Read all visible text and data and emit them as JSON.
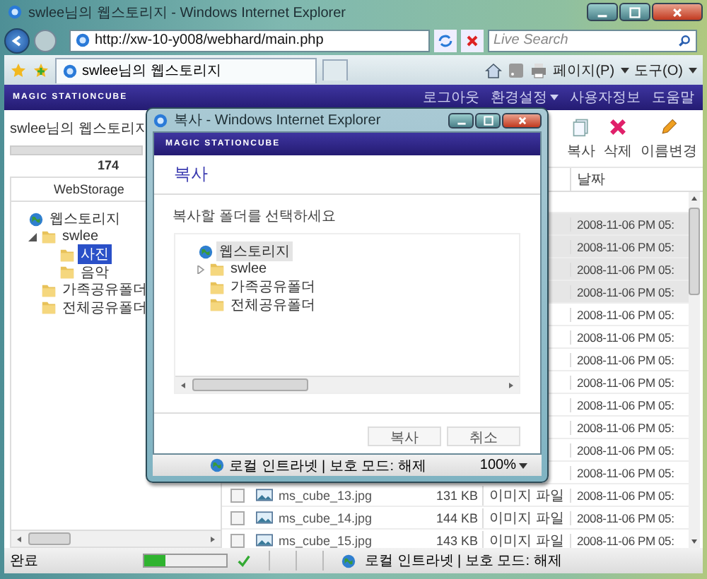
{
  "window": {
    "title": "swlee님의 웹스토리지 - Windows Internet Explorer"
  },
  "address_bar": {
    "url": "http://xw-10-y008/webhard/main.php"
  },
  "search": {
    "placeholder": "Live Search"
  },
  "tab": {
    "label": "swlee님의 웹스토리지"
  },
  "command_bar": [
    "페이지(P)",
    "도구(O)"
  ],
  "site": {
    "logo": "MAGIC STATIONCUBE",
    "links": [
      {
        "label": "로그아웃",
        "dropdown": false
      },
      {
        "label": "환경설정",
        "dropdown": true
      },
      {
        "label": "사용자정보",
        "dropdown": false
      },
      {
        "label": "도움말",
        "dropdown": false
      }
    ]
  },
  "storage": {
    "title": "swlee님의 웹스토리지",
    "usage": "174"
  },
  "tree": {
    "header": "WebStorage",
    "items": [
      {
        "label": "웹스토리지",
        "kind": "root",
        "selected": false,
        "children": [
          {
            "label": "swlee",
            "kind": "expanded_folder",
            "selected": false,
            "children": [
              {
                "label": "사진",
                "kind": "folder",
                "selected": true
              },
              {
                "label": "음악",
                "kind": "folder",
                "selected": false
              }
            ]
          },
          {
            "label": "가족공유폴더",
            "kind": "folder",
            "selected": false
          },
          {
            "label": "전체공유폴더",
            "kind": "folder",
            "selected": false
          }
        ]
      }
    ]
  },
  "toolbar": [
    {
      "label": "복사",
      "kind": "copy"
    },
    {
      "label": "삭제",
      "kind": "delete"
    },
    {
      "label": "이름변경",
      "kind": "rename"
    }
  ],
  "table": {
    "columns": [
      "날짜"
    ],
    "rows": [
      {
        "selected": true,
        "date": "2008-11-06 PM 05:"
      },
      {
        "selected": true,
        "date": "2008-11-06 PM 05:"
      },
      {
        "selected": true,
        "date": "2008-11-06 PM 05:"
      },
      {
        "selected": true,
        "date": "2008-11-06 PM 05:"
      },
      {
        "selected": false,
        "date": "2008-11-06 PM 05:"
      },
      {
        "selected": false,
        "date": "2008-11-06 PM 05:"
      },
      {
        "selected": false,
        "date": "2008-11-06 PM 05:"
      },
      {
        "selected": false,
        "date": "2008-11-06 PM 05:"
      },
      {
        "selected": false,
        "date": "2008-11-06 PM 05:"
      },
      {
        "selected": false,
        "date": "2008-11-06 PM 05:"
      },
      {
        "selected": false,
        "date": "2008-11-06 PM 05:"
      },
      {
        "selected": false,
        "date": "2008-11-06 PM 05:"
      },
      {
        "selected": false,
        "checked": false,
        "name": "ms_cube_13.jpg",
        "size": "131 KB",
        "type": "이미지 파일",
        "date": "2008-11-06 PM 05:"
      },
      {
        "selected": false,
        "checked": false,
        "name": "ms_cube_14.jpg",
        "size": "144 KB",
        "type": "이미지 파일",
        "date": "2008-11-06 PM 05:"
      },
      {
        "selected": false,
        "checked": false,
        "name": "ms_cube_15.jpg",
        "size": "143 KB",
        "type": "이미지 파일",
        "date": "2008-11-06 PM 05:"
      }
    ]
  },
  "dialog": {
    "title": "복사 - Windows Internet Explorer",
    "logo": "MAGIC STATIONCUBE",
    "heading": "복사",
    "instruction": "복사할 폴더를 선택하세요",
    "tree": [
      {
        "label": "웹스토리지",
        "kind": "root",
        "selected": true,
        "children": [
          {
            "label": "swlee",
            "kind": "collapsed_folder",
            "selected": false
          },
          {
            "label": "가족공유폴더",
            "kind": "folder",
            "selected": false
          },
          {
            "label": "전체공유폴더",
            "kind": "folder",
            "selected": false
          }
        ]
      }
    ],
    "buttons": [
      "복사",
      "취소"
    ],
    "status": {
      "zone": "로컬 인트라넷 | 보호 모드: 해제",
      "zoom": "100%"
    }
  },
  "status_bar": {
    "text": "완료",
    "level": 0.25,
    "zone": "로컬 인트라넷 | 보호 모드: 해제"
  }
}
